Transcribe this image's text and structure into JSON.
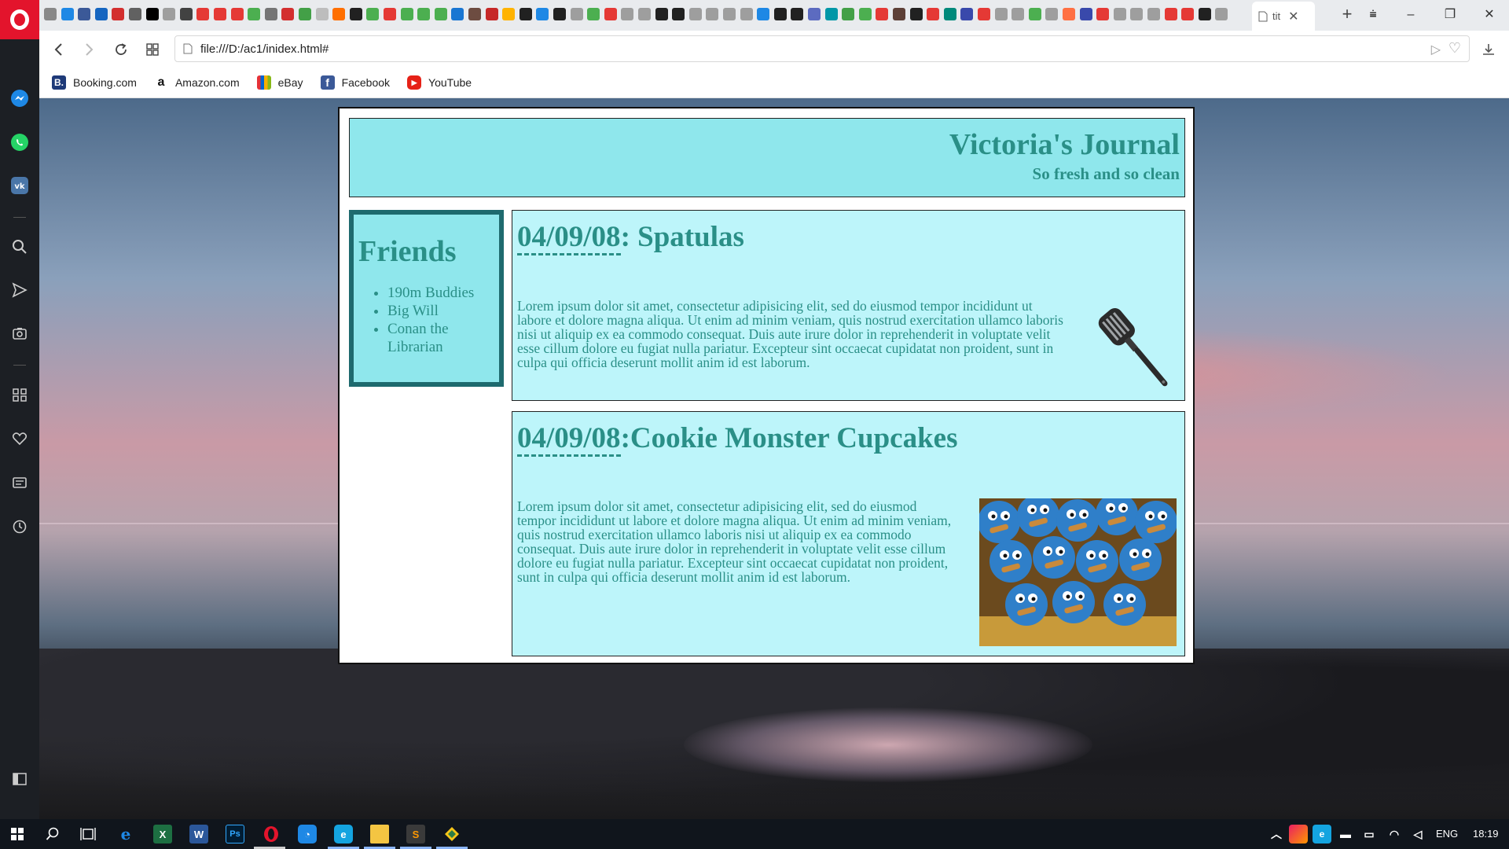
{
  "browser": {
    "active_tab_title": "tit",
    "url": "file:///D:/ac1/inidex.html#",
    "bookmarks": [
      {
        "label": "Booking.com",
        "icon": "booking-icon",
        "color": "#1e3a78",
        "glyph": "B."
      },
      {
        "label": "Amazon.com",
        "icon": "amazon-icon",
        "color": "#ffffff",
        "glyph": "a"
      },
      {
        "label": "eBay",
        "icon": "ebay-icon",
        "color": "#e53238",
        "glyph": ""
      },
      {
        "label": "Facebook",
        "icon": "facebook-icon",
        "color": "#3b5998",
        "glyph": "f"
      },
      {
        "label": "YouTube",
        "icon": "youtube-icon",
        "color": "#e62117",
        "glyph": "▶"
      }
    ],
    "tab_favicons": [
      "#888",
      "#1e88e5",
      "#3b5998",
      "#1565c0",
      "#d32f2f",
      "#616161",
      "#000000",
      "#9e9e9e",
      "#424242",
      "#e53935",
      "#e53935",
      "#e53935",
      "#4caf50",
      "#757575",
      "#d32f2f",
      "#43a047",
      "#bdbdbd",
      "#ff6f00",
      "#212121",
      "#4caf50",
      "#e53935",
      "#4caf50",
      "#4caf50",
      "#4caf50",
      "#1976d2",
      "#6d4c41",
      "#c62828",
      "#ffb300",
      "#212121",
      "#1e88e5",
      "#212121",
      "#9e9e9e",
      "#4caf50",
      "#e53935",
      "#9e9e9e",
      "#9e9e9e",
      "#212121",
      "#212121",
      "#9e9e9e",
      "#9e9e9e",
      "#9e9e9e",
      "#9e9e9e",
      "#1e88e5",
      "#212121",
      "#212121",
      "#5c6bc0",
      "#0097a7",
      "#43a047",
      "#4caf50",
      "#e53935",
      "#5d4037",
      "#212121",
      "#e53935",
      "#00897b",
      "#3949ab",
      "#e53935",
      "#9e9e9e",
      "#9e9e9e",
      "#4caf50",
      "#9e9e9e",
      "#ff7043",
      "#3949ab",
      "#e53935",
      "#9e9e9e",
      "#9e9e9e",
      "#9e9e9e",
      "#e53935",
      "#e53935",
      "#212121",
      "#9e9e9e"
    ],
    "accent": "#e3142c"
  },
  "journal": {
    "title": "Victoria's Journal",
    "subtitle": "So fresh and so clean",
    "friends_heading": "Friends",
    "friends": [
      "190m Buddies",
      "Big Will",
      "Conan the Librarian"
    ],
    "posts": [
      {
        "date": "04/09/08",
        "separator": ": ",
        "title": "Spatulas",
        "body": "Lorem ipsum dolor sit amet, consectetur adipisicing elit, sed do eiusmod tempor incididunt ut labore et dolore magna aliqua. Ut enim ad minim veniam, quis nostrud exercitation ullamco laboris nisi ut aliquip ex ea commodo consequat. Duis aute irure dolor in reprehenderit in voluptate velit esse cillum dolore eu fugiat nulla pariatur. Excepteur sint occaecat cupidatat non proident, sunt in culpa qui officia deserunt mollit anim id est laborum.",
        "image": "spatula-image"
      },
      {
        "date": "04/09/08",
        "separator": ":",
        "title": "Cookie Monster Cupcakes",
        "body": "Lorem ipsum dolor sit amet, consectetur adipisicing elit, sed do eiusmod tempor incididunt ut labore et dolore magna aliqua. Ut enim ad minim veniam, quis nostrud exercitation ullamco laboris nisi ut aliquip ex ea commodo consequat. Duis aute irure dolor in reprehenderit in voluptate velit esse cillum dolore eu fugiat nulla pariatur. Excepteur sint occaecat cupidatat non proident, sunt in culpa qui officia deserunt mollit anim id est laborum.",
        "image": "cupcakes-image"
      }
    ],
    "colors": {
      "header_bg": "#8fe7ec",
      "post_bg": "#bdf5fa",
      "text": "#2a8f87",
      "border": "#1e6a6e"
    }
  },
  "taskbar": {
    "language": "ENG",
    "time": "18:19"
  }
}
